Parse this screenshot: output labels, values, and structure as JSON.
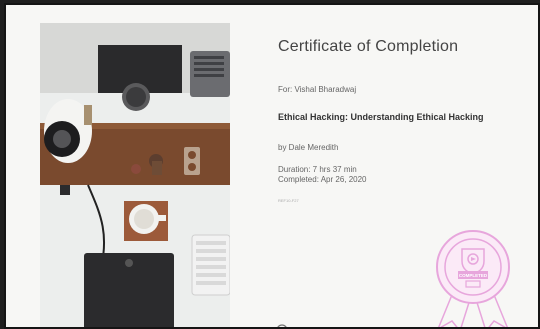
{
  "certificate": {
    "title": "Certificate of Completion",
    "recipient": "For: Vishal Bharadwaj",
    "course_title": "Ethical Hacking: Understanding Ethical Hacking",
    "author": "by Dale Meredith",
    "duration": "Duration: 7 hrs 37 min",
    "completed": "Completed: Apr 26, 2020",
    "reference": "REF10-F27"
  },
  "badge": {
    "label": "COMPLETED",
    "color": "#e7a6dc"
  },
  "colors": {
    "paper": "#f7f7f5",
    "frame": "#151515",
    "desk_wall": "#e9ebea",
    "desk_shelf": "#7a4a2e",
    "dark_board": "#2b2b2d"
  }
}
